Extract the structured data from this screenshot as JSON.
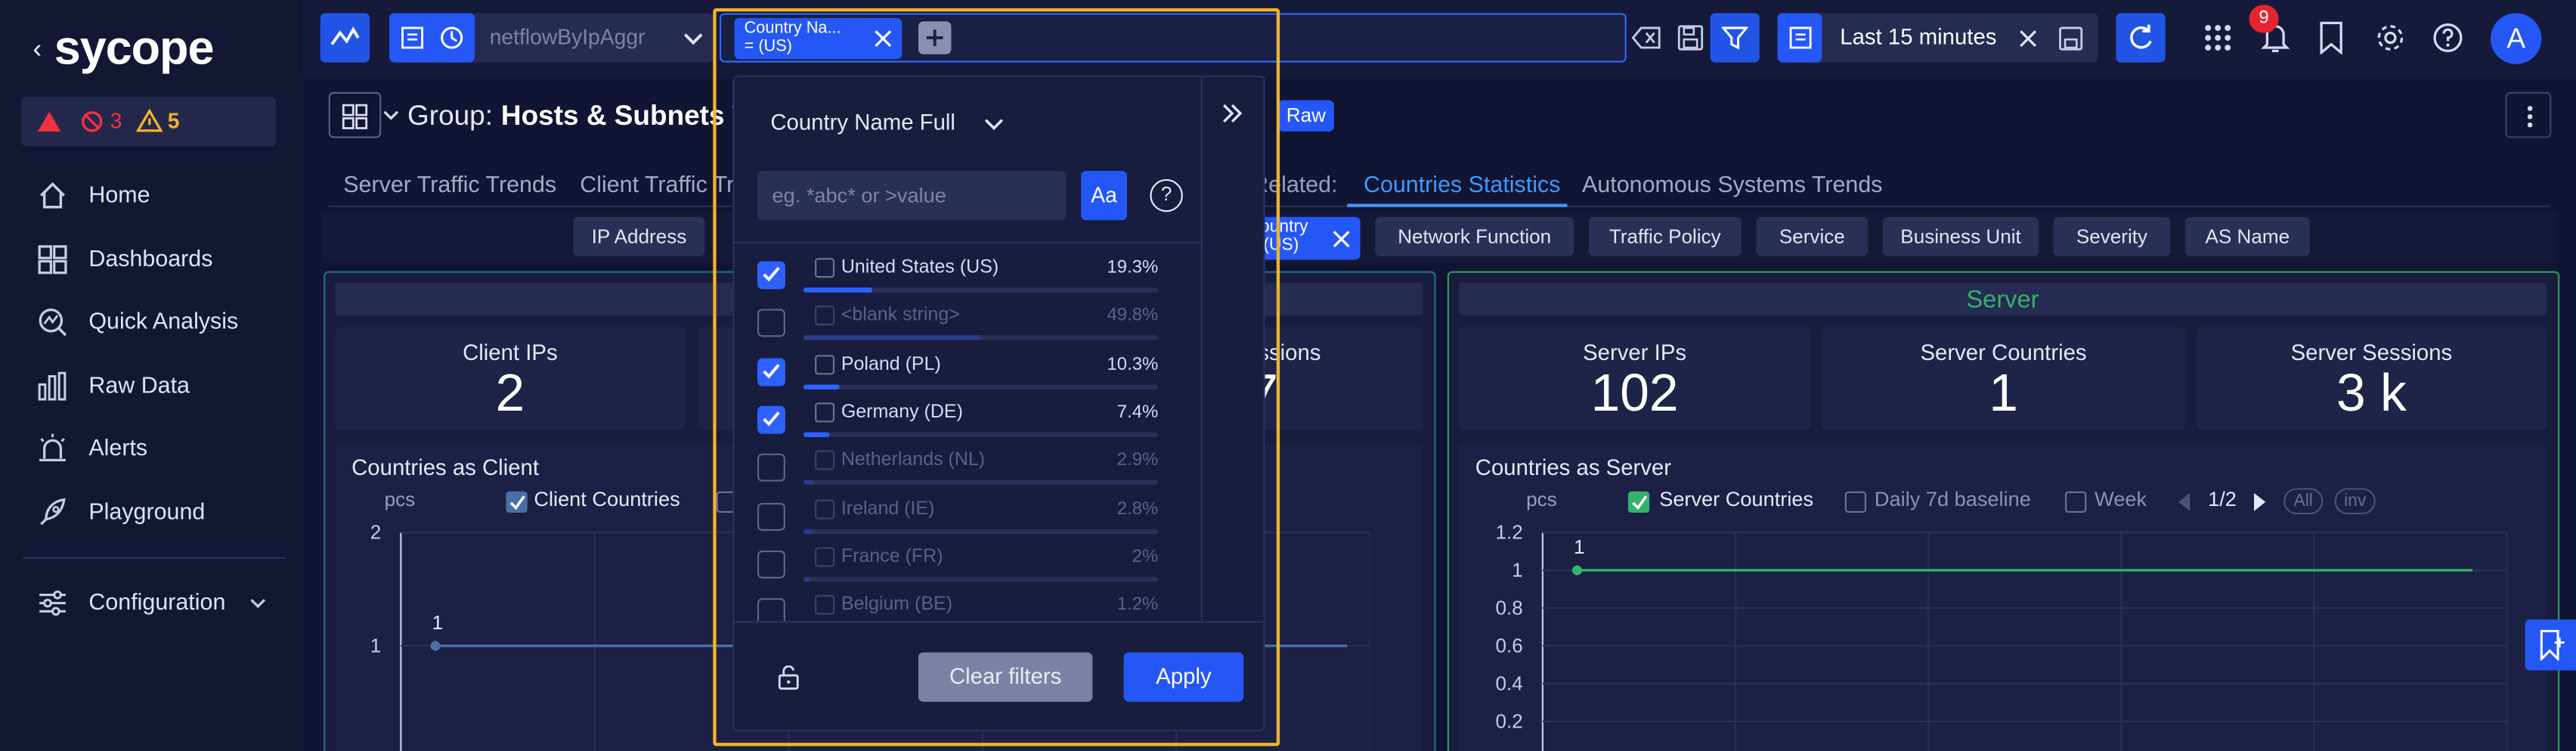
{
  "sidebar": {
    "logo": "sycope",
    "alert_critical_count": "3",
    "alert_warning_count": "5",
    "items": [
      {
        "label": "Home"
      },
      {
        "label": "Dashboards"
      },
      {
        "label": "Quick Analysis"
      },
      {
        "label": "Raw Data"
      },
      {
        "label": "Alerts"
      },
      {
        "label": "Playground"
      },
      {
        "label": "Configuration"
      }
    ]
  },
  "topbar": {
    "source": "netflowByIpAggr",
    "chip_line1": "Country Na...",
    "chip_line2": "= (US)",
    "time_range": "Last 15 minutes",
    "notification_count": "9",
    "avatar": "A"
  },
  "page": {
    "group_prefix": "Group:",
    "group_name": "Hosts & Subnets Tr",
    "raw_badge": "Raw",
    "tabs": [
      "Server Traffic Trends",
      "Client Traffic Tr"
    ],
    "related_label": "Related:",
    "related_tabs": [
      "Countries Statistics",
      "Autonomous Systems Trends"
    ],
    "filter_pills": [
      "IP Address",
      "Network Function",
      "Traffic Policy",
      "Service",
      "Business Unit",
      "Severity",
      "AS Name"
    ],
    "active_pill_line1": "ountry",
    "active_pill_line2": "(US)"
  },
  "client_section": {
    "kpis": [
      {
        "title": "Client IPs",
        "value": "2"
      },
      {
        "title": "ssions",
        "value": "7"
      }
    ],
    "chart_title": "Countries as Client",
    "legend_unit": "pcs",
    "legend_series": "Client Countries",
    "chart_data": {
      "type": "line",
      "title": "Countries as Client",
      "ylabel": "pcs",
      "ylim": [
        0,
        2
      ],
      "yticks": [
        "2",
        "1"
      ],
      "series": [
        {
          "name": "Client Countries",
          "values": [
            1,
            1
          ]
        }
      ],
      "point_label": "1",
      "color": "#4a6fa8"
    }
  },
  "server_section": {
    "title": "Server",
    "kpis": [
      {
        "title": "Server IPs",
        "value": "102"
      },
      {
        "title": "Server Countries",
        "value": "1"
      },
      {
        "title": "Server Sessions",
        "value": "3 k"
      }
    ],
    "chart_title": "Countries as Server",
    "legend_unit": "pcs",
    "legend_series": "Server Countries",
    "legend_baseline": "Daily 7d baseline",
    "legend_week": "Week",
    "pager": "1/2",
    "btn_all": "All",
    "btn_inv": "inv",
    "chart_data": {
      "type": "line",
      "title": "Countries as Server",
      "ylabel": "pcs",
      "ylim": [
        0,
        1.2
      ],
      "yticks": [
        "1.2",
        "1",
        "0.8",
        "0.6",
        "0.4",
        "0.2"
      ],
      "series": [
        {
          "name": "Server Countries",
          "values": [
            1,
            1
          ]
        }
      ],
      "point_label": "1",
      "color": "#33b36b"
    }
  },
  "popup": {
    "field": "Country Name Full",
    "search_placeholder": "eg. *abc* or >value",
    "case_btn": "Aa",
    "help": "?",
    "rows": [
      {
        "name": "United States (US)",
        "pct": "19.3%",
        "value": 0.193,
        "checked": true,
        "dim": false
      },
      {
        "name": "<blank string>",
        "pct": "49.8%",
        "value": 0.498,
        "checked": false,
        "dim": true
      },
      {
        "name": "Poland (PL)",
        "pct": "10.3%",
        "value": 0.103,
        "checked": true,
        "dim": false
      },
      {
        "name": "Germany (DE)",
        "pct": "7.4%",
        "value": 0.074,
        "checked": true,
        "dim": false
      },
      {
        "name": "Netherlands (NL)",
        "pct": "2.9%",
        "value": 0.029,
        "checked": false,
        "dim": true
      },
      {
        "name": "Ireland (IE)",
        "pct": "2.8%",
        "value": 0.028,
        "checked": false,
        "dim": true
      },
      {
        "name": "France (FR)",
        "pct": "2%",
        "value": 0.02,
        "checked": false,
        "dim": true
      },
      {
        "name": "Belgium (BE)",
        "pct": "1.2%",
        "value": 0.012,
        "checked": false,
        "dim": true
      }
    ],
    "clear_label": "Clear filters",
    "apply_label": "Apply"
  },
  "colors": {
    "accent": "#2457f5",
    "highlight": "#f0b429",
    "server": "#33b36b"
  }
}
